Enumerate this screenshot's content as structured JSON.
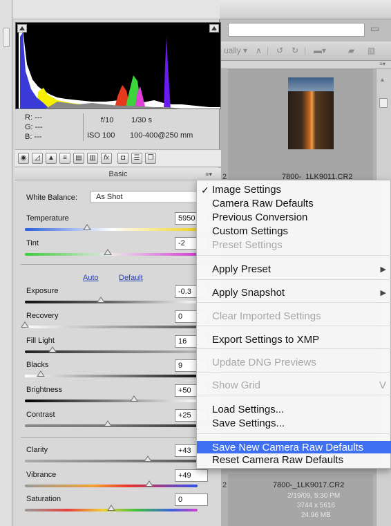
{
  "bridge": {
    "toolbar_sort_label": "ually",
    "thumb1_name": "7800-_1LK9011.CR2",
    "thumb2_name": "7800-_1LK9017.CR2",
    "thumb2_date": "2/19/09, 5:30 PM",
    "thumb2_dims": "3744 x 5616",
    "thumb2_size": "24.96 MB",
    "partial_num_top": "2",
    "partial_num_bottom": "2"
  },
  "readout": {
    "r_label": "R:",
    "g_label": "G:",
    "b_label": "B:",
    "r_value": "---",
    "g_value": "---",
    "b_value": "---",
    "aperture": "f/10",
    "shutter": "1/30 s",
    "iso": "ISO 100",
    "lens": "100-400@250 mm"
  },
  "panel": {
    "section_title": "Basic",
    "white_balance_label": "White Balance:",
    "white_balance_value": "As Shot",
    "auto_link": "Auto",
    "default_link": "Default",
    "sliders": [
      {
        "label": "Temperature",
        "value": "5950",
        "pos": 0.36
      },
      {
        "label": "Tint",
        "value": "-2",
        "pos": 0.48
      },
      {
        "label": "Exposure",
        "value": "-0.3",
        "pos": 0.44
      },
      {
        "label": "Recovery",
        "value": "0",
        "pos": 0.0
      },
      {
        "label": "Fill Light",
        "value": "16",
        "pos": 0.16
      },
      {
        "label": "Blacks",
        "value": "9",
        "pos": 0.09
      },
      {
        "label": "Brightness",
        "value": "+50",
        "pos": 0.63
      },
      {
        "label": "Contrast",
        "value": "+25",
        "pos": 0.48
      },
      {
        "label": "Clarity",
        "value": "+43",
        "pos": 0.71
      },
      {
        "label": "Vibrance",
        "value": "+49",
        "pos": 0.72
      },
      {
        "label": "Saturation",
        "value": "0",
        "pos": 0.5
      }
    ]
  },
  "menu": {
    "items": [
      {
        "label": "Image Settings",
        "checked": true
      },
      {
        "label": "Camera Raw Defaults"
      },
      {
        "label": "Previous Conversion"
      },
      {
        "label": "Custom Settings"
      },
      {
        "label": "Preset Settings",
        "disabled": true
      },
      {
        "label": "Apply Preset",
        "submenu": true
      },
      {
        "label": "Apply Snapshot",
        "submenu": true
      },
      {
        "label": "Clear Imported Settings",
        "disabled": true
      },
      {
        "label": "Export Settings to XMP"
      },
      {
        "label": "Update DNG Previews",
        "disabled": true
      },
      {
        "label": "Show Grid",
        "disabled": true,
        "shortcut": "V"
      },
      {
        "label": "Load Settings..."
      },
      {
        "label": "Save Settings..."
      },
      {
        "label": "Save New Camera Raw Defaults",
        "highlighted": true
      },
      {
        "label": "Reset Camera Raw Defaults"
      }
    ],
    "check_mark": "✓",
    "submenu_arrow": "▶"
  },
  "colors": {
    "highlight": "#3d6ff0",
    "link": "#2a3fb0"
  }
}
